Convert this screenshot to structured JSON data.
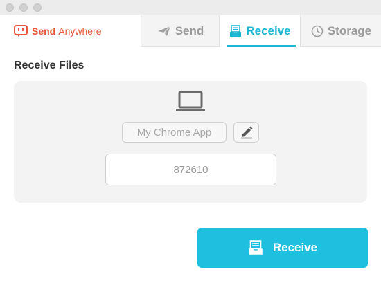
{
  "brand": {
    "name_bold": "Send",
    "name_rest": "Anywhere",
    "color": "#e8553a"
  },
  "tabs": [
    {
      "label": "Send",
      "icon": "paper-plane-icon",
      "active": false
    },
    {
      "label": "Receive",
      "icon": "inbox-tray-icon",
      "active": true
    },
    {
      "label": "Storage",
      "icon": "clock-icon",
      "active": false
    }
  ],
  "main": {
    "heading": "Receive Files",
    "device_icon": "laptop-icon",
    "device_name": "My Chrome App",
    "edit_icon": "pencil-icon",
    "key_value": "872610",
    "receive_button": {
      "label": "Receive",
      "icon": "inbox-tray-icon"
    }
  },
  "colors": {
    "accent": "#1fb6d4",
    "button": "#1fc0df",
    "panel": "#f3f3f3"
  }
}
